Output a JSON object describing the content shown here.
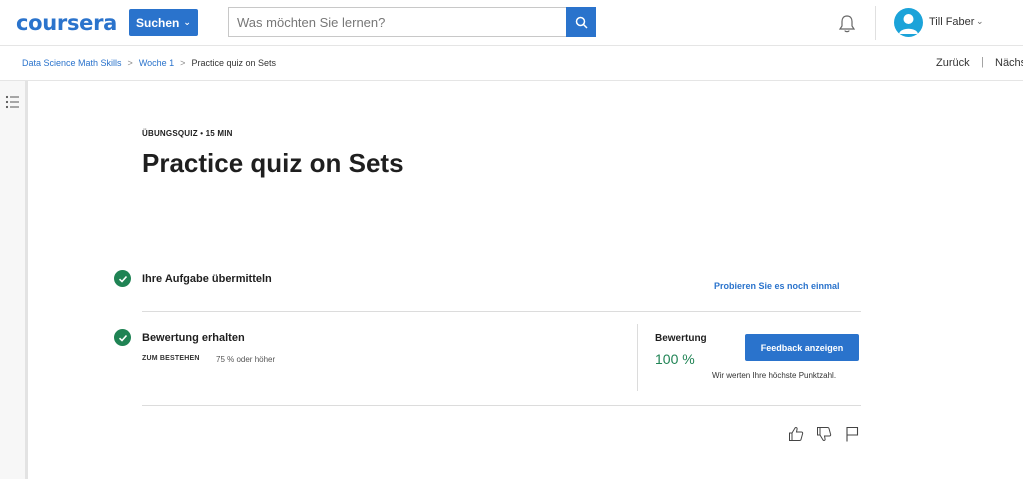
{
  "header": {
    "logo": "coursera",
    "search_button_label": "Suchen",
    "search_placeholder": "Was möchten Sie lernen?",
    "search_value": "",
    "user_name": "Till Faber",
    "brand_color": "#2a73cc"
  },
  "breadcrumb": {
    "items": [
      "Data Science Math Skills",
      "Woche 1"
    ],
    "current": "Practice quiz on Sets",
    "separator": ">"
  },
  "navigation": {
    "back_label": "Zurück",
    "separator": "|",
    "next_label": "Nächs"
  },
  "quiz": {
    "kicker": "ÜBUNGSQUIZ • 15 MIN",
    "title": "Practice quiz on Sets",
    "step1": {
      "title": "Ihre Aufgabe übermitteln",
      "retry_link": "Probieren Sie es noch einmal"
    },
    "step2": {
      "title": "Bewertung erhalten",
      "pass_label": "ZUM BESTEHEN",
      "pass_value": "75 % oder höher",
      "grade_label": "Bewertung",
      "grade_value": "100 %",
      "feedback_button": "Feedback anzeigen",
      "grade_note": "Wir werten Ihre höchste Punktzahl."
    },
    "success_color": "#1f8354"
  },
  "icons": {
    "search": "search-icon",
    "bell": "bell-icon",
    "avatar": "user-avatar-icon",
    "menu": "list-menu-icon",
    "check": "checkmark-icon",
    "like": "thumbs-up-icon",
    "dislike": "thumbs-down-icon",
    "flag": "flag-icon"
  }
}
